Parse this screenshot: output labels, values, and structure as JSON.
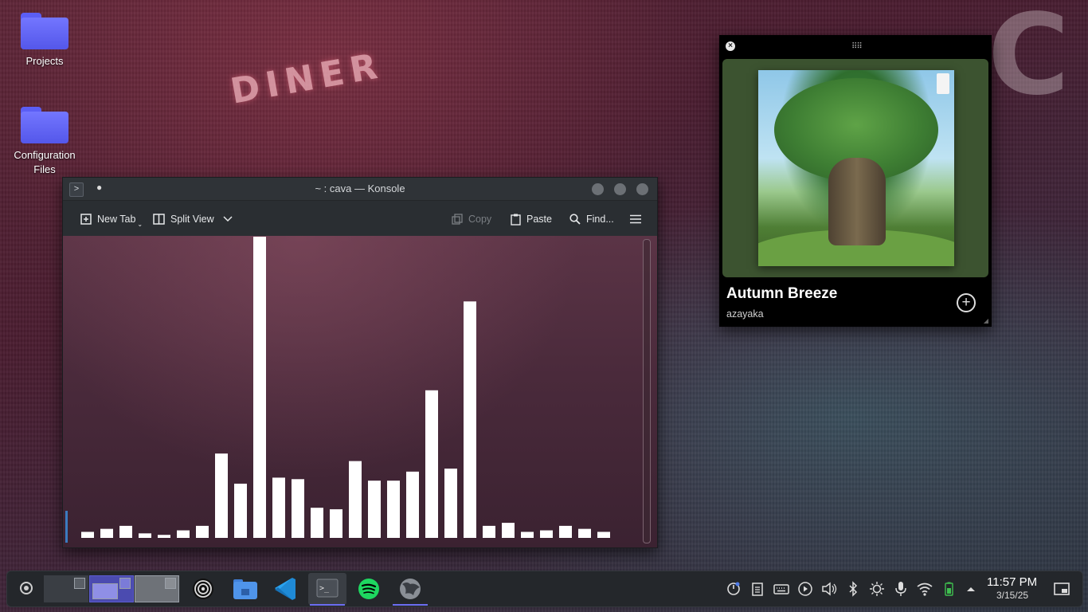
{
  "desktop": {
    "icons": [
      {
        "label": "Projects",
        "icon": "folder-icon"
      },
      {
        "label": "Configuration\nFiles",
        "icon": "folder-icon"
      }
    ],
    "wallpaper_signs": {
      "diner": "DINER",
      "c": "C"
    }
  },
  "konsole": {
    "title": "~ : cava — Konsole",
    "app_icon": ">",
    "toolbar": {
      "new_tab": "New Tab",
      "split_view": "Split View",
      "copy": "Copy",
      "paste": "Paste",
      "find": "Find..."
    },
    "cava_levels": [
      0.02,
      0.03,
      0.04,
      0.015,
      0.01,
      0.025,
      0.04,
      0.28,
      0.18,
      1.0,
      0.2,
      0.195,
      0.1,
      0.095,
      0.255,
      0.19,
      0.19,
      0.22,
      0.49,
      0.23,
      0.785,
      0.04,
      0.05,
      0.02,
      0.025,
      0.04,
      0.03,
      0.02
    ]
  },
  "player": {
    "track_title": "Autumn Breeze",
    "artist": "azayaka",
    "close_icon": "close-icon",
    "add_icon": "add-icon",
    "art_colors": {
      "card_bg": "#3c5330"
    }
  },
  "taskbar": {
    "launcher_icon": "app-launcher-icon",
    "tasks": [
      {
        "name": "obs-icon",
        "active": false
      },
      {
        "name": "file-manager-icon",
        "active": false
      },
      {
        "name": "vscode-icon",
        "active": false
      },
      {
        "name": "konsole-icon",
        "active": true
      },
      {
        "name": "spotify-icon",
        "active": false
      },
      {
        "name": "browser-icon",
        "active": true
      }
    ],
    "clock": {
      "time": "11:57 PM",
      "date": "3/15/25"
    },
    "accent": "#6b6cf0"
  }
}
